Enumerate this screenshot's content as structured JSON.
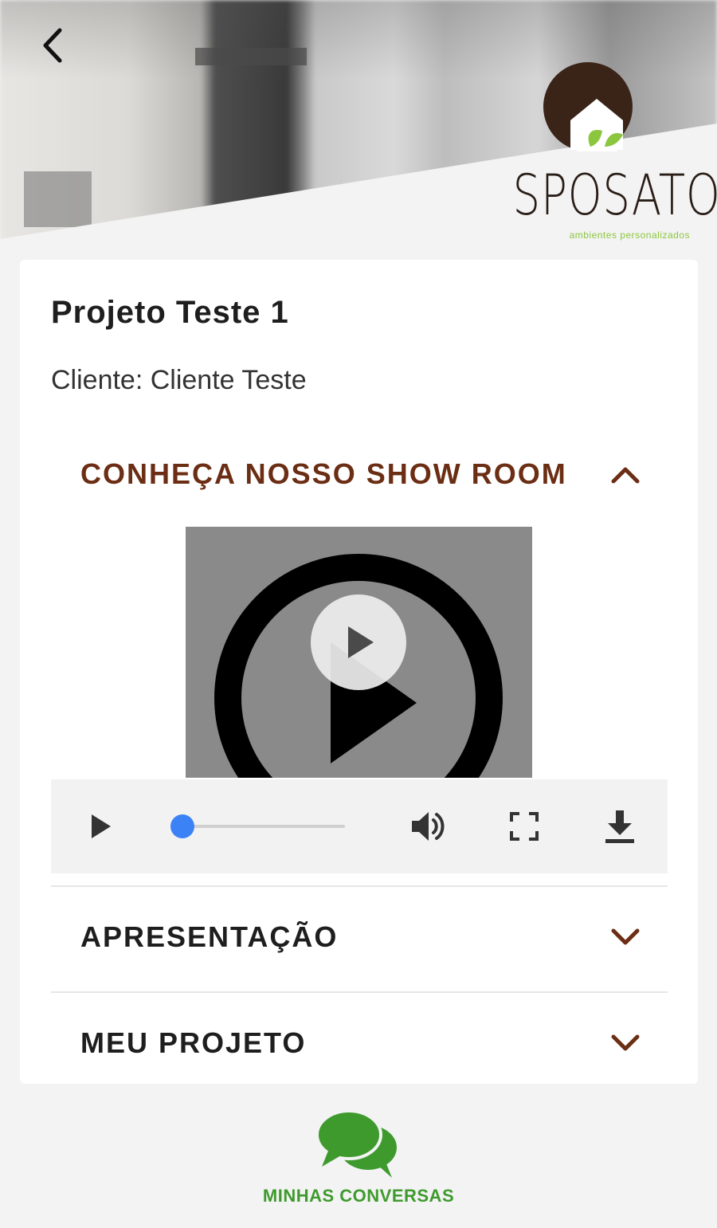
{
  "header": {
    "back_icon": "chevron-left-icon",
    "logo": {
      "wordmark": "SPOSATO",
      "tagline": "ambientes personalizados"
    }
  },
  "project": {
    "title": "Projeto Teste 1",
    "client_line": "Cliente: Cliente Teste"
  },
  "sections": [
    {
      "label": "CONHEÇA NOSSO SHOW ROOM",
      "expanded": true,
      "color": "#6b2e14",
      "chevron": "chevron-up-icon"
    },
    {
      "label": "APRESENTAÇÃO",
      "expanded": false,
      "color": "#1e1e1e",
      "chevron": "chevron-down-icon"
    },
    {
      "label": "MEU PROJETO",
      "expanded": false,
      "color": "#1e1e1e",
      "chevron": "chevron-down-icon"
    }
  ],
  "video_player": {
    "progress": 0,
    "controls": [
      "play-icon",
      "volume-icon",
      "fullscreen-icon",
      "download-icon"
    ]
  },
  "bottom_nav": {
    "label": "MINHAS CONVERSAS",
    "icon": "chat-bubbles-icon",
    "color": "#3f9a2e"
  },
  "colors": {
    "accent_brown": "#6b2e14",
    "logo_dark": "#2a1d17",
    "leaf_green": "#8cc63f",
    "nav_green": "#3f9a2e",
    "seek_blue": "#3b82f6"
  }
}
